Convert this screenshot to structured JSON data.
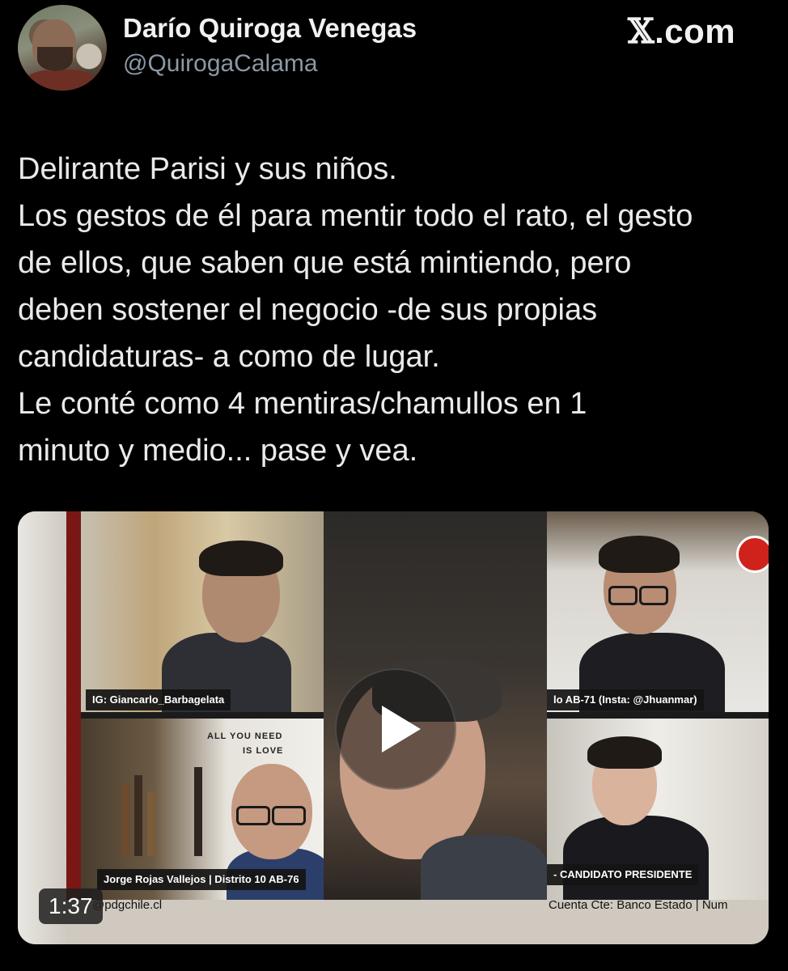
{
  "author": {
    "name": "Darío Quiroga Venegas",
    "handle": "@QuirogaCalama"
  },
  "brand": {
    "x_glyph": "𝕏",
    "domain": ".com"
  },
  "tweet": {
    "lines": [
      "Delirante Parisi y sus niños.",
      "Los gestos de él para mentir todo el rato, el gesto",
      "de ellos, que saben que está mintiendo, pero",
      "deben sostener el negocio -de sus propias",
      "candidaturas- a como de lugar.",
      "Le conté como 4 mentiras/chamullos en 1",
      "minuto y medio... pase y vea."
    ]
  },
  "video": {
    "duration": "1:37",
    "captions": {
      "top_left": "IG: Giancarlo_Barbagelata",
      "top_right": "lo AB-71 (Insta: @Jhuanmar)",
      "bottom_left": "Jorge Rojas Vallejos | Distrito 10 AB-76",
      "bottom_right": "- CANDIDATO PRESIDENTE"
    },
    "poster_text": [
      "ALL YOU NEED",
      "IS LOVE"
    ],
    "channel_logo": "PD",
    "footer_left": "@pdgchile.cl",
    "footer_right": "Cuenta Cte: Banco Estado | Num"
  }
}
